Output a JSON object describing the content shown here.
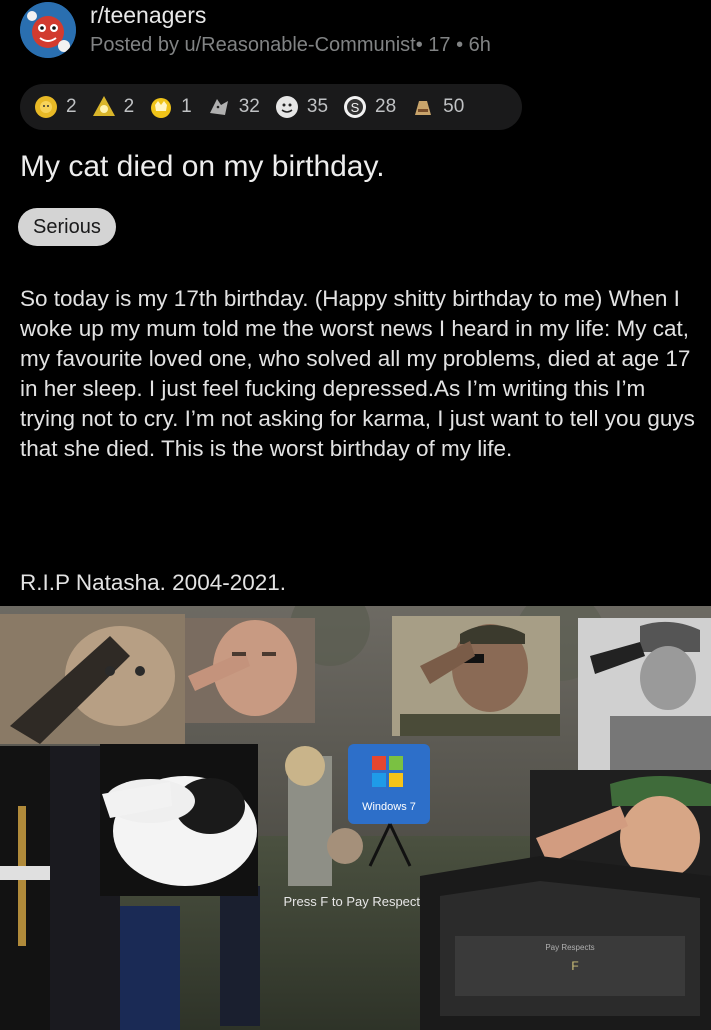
{
  "post": {
    "subreddit": "r/teenagers",
    "posted_by": "Posted by u/Reasonable-Communist• 17 • 6h",
    "title": "My cat died on my birthday.",
    "flair": "Serious",
    "body": "So today is my 17th birthday. (Happy shitty birthday to me) When I woke up my mum told me the worst news I heard in my life: My cat, my favourite loved one, who solved all my problems, died at age 17 in her sleep. I just feel fucking depressed.As I’m writing this I’m trying not to cry. I’m not asking for karma, I just want to tell you guys that she died. This is the worst birthday of my life.",
    "closing": "R.I.P Natasha. 2004-2021."
  },
  "awards": [
    {
      "icon": "silver-sun-award-icon",
      "count": "2",
      "color": "#e8b926"
    },
    {
      "icon": "helpful-award-icon",
      "count": "2",
      "color": "#d9b52a"
    },
    {
      "icon": "gold-crown-award-icon",
      "count": "1",
      "color": "#f0c419"
    },
    {
      "icon": "cat-slap-award-icon",
      "count": "32",
      "color": "#b0b0b0"
    },
    {
      "icon": "wholesome-award-icon",
      "count": "35",
      "color": "#e6e6e6"
    },
    {
      "icon": "coin-award-icon",
      "count": "28",
      "color": "#f2f2f2"
    },
    {
      "icon": "press-f-award-icon",
      "count": "50",
      "color": "#c9a46b"
    }
  ],
  "meme": {
    "windows_logo_text": "Windows 7",
    "press_f_text": "Press F to Pay Respects",
    "coffin_label": "Pay Respects",
    "coffin_key": "F"
  }
}
